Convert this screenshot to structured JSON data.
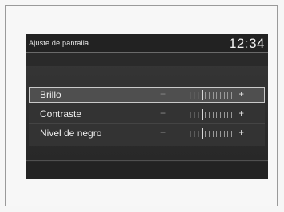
{
  "header": {
    "title": "Ajuste de pantalla",
    "clock": "12:34"
  },
  "settings": [
    {
      "label": "Brillo",
      "minus": "−",
      "plus": "+",
      "level": 0.5,
      "selected": true
    },
    {
      "label": "Contraste",
      "minus": "−",
      "plus": "+",
      "level": 0.5,
      "selected": false
    },
    {
      "label": "Nivel de negro",
      "minus": "−",
      "plus": "+",
      "level": 0.5,
      "selected": false
    }
  ],
  "colors": {
    "screen_bg": "#2c2c2c",
    "text": "#eeeeee",
    "selected_row": "#4f4f4f"
  }
}
